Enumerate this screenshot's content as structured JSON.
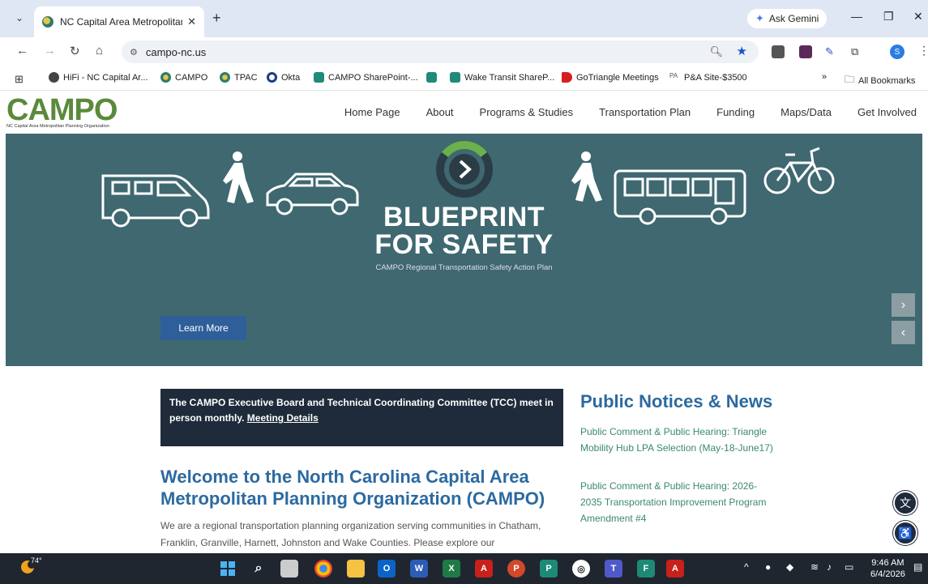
{
  "browser": {
    "tab_title": "NC Capital Area Metropolitan P",
    "url": "campo-nc.us",
    "ask_gemini": "Ask Gemini",
    "profile_initial": "S",
    "bookmarks": [
      {
        "label": "HiFi - NC Capital Ar...",
        "icon": "globe-icon"
      },
      {
        "label": "CAMPO",
        "icon": "campo-icon"
      },
      {
        "label": "TPAC",
        "icon": "campo-icon"
      },
      {
        "label": "Okta",
        "icon": "okta-icon"
      },
      {
        "label": "CAMPO SharePoint-...",
        "icon": "sharepoint-icon"
      },
      {
        "label": "",
        "icon": "sharepoint-icon"
      },
      {
        "label": "Wake Transit ShareP...",
        "icon": "sharepoint-icon"
      },
      {
        "label": "GoTriangle Meetings",
        "icon": "gotriangle-icon"
      },
      {
        "label": "P&A Site-$3500",
        "icon": "pa-icon"
      }
    ],
    "more_bookmarks": "»",
    "all_bookmarks": "All Bookmarks"
  },
  "site": {
    "logo_text": "CAMPO",
    "logo_sub": "NC Capital Area Metropolitan Planning Organization",
    "nav": [
      "Home Page",
      "About",
      "Programs & Studies",
      "Transportation Plan",
      "Funding",
      "Maps/Data",
      "Get Involved"
    ]
  },
  "hero": {
    "title_line1": "BLUEPRINT",
    "title_line2": "FOR SAFETY",
    "subtitle": "CAMPO Regional Transportation Safety Action Plan",
    "cta": "Learn More",
    "next": "›",
    "prev": "‹"
  },
  "content": {
    "meeting_text": "The CAMPO Executive Board and Technical Coordinating Committee (TCC) meet in person monthly.",
    "meeting_link": "Meeting Details",
    "welcome_title": "Welcome to the North Carolina Capital Area Metropolitan Planning Organization (CAMPO)",
    "welcome_body": "We are a regional transportation planning organization serving communities in Chatham, Franklin, Granville, Harnett, Johnston and Wake Counties. Please explore our",
    "notices_title": "Public Notices & News",
    "notices": [
      "Public Comment & Public Hearing: Triangle Mobility Hub LPA Selection (May-18-June17)",
      "Public Comment & Public Hearing: 2026-2035 Transportation Improvement Program Amendment #4"
    ]
  },
  "taskbar": {
    "temperature": "74°",
    "time": "9:46 AM",
    "date": "6/4/2026"
  },
  "colors": {
    "hero_bg": "#3f6870",
    "link_blue": "#2c6aa0",
    "notice_green": "#3a8a6a",
    "dark_box": "#1f2b3a",
    "cta_blue": "#2e5f9a"
  }
}
